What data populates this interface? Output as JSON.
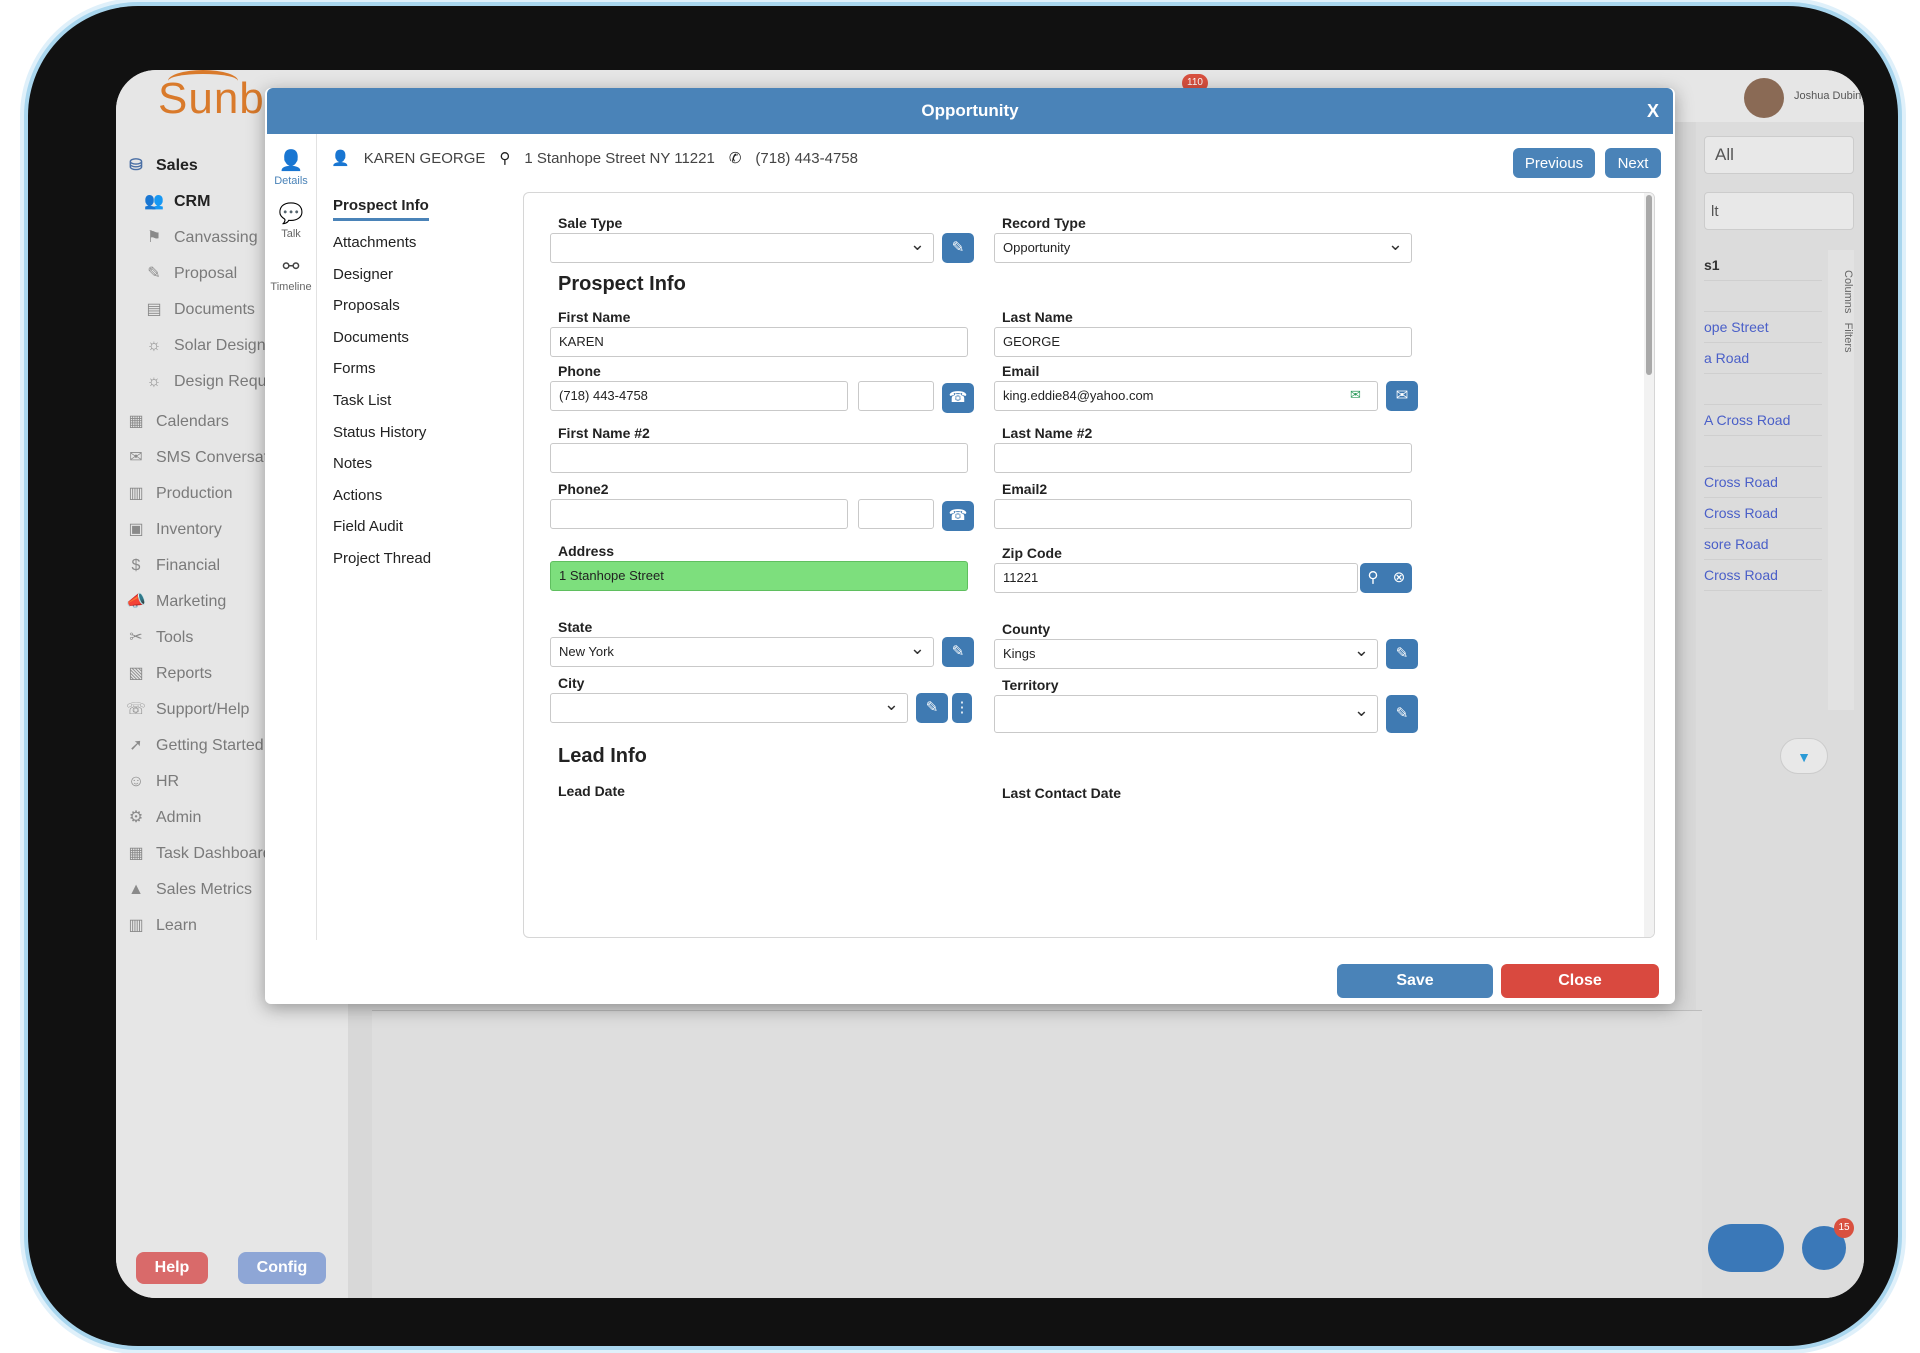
{
  "app": {
    "brand": "Sunbas",
    "user_name": "Joshua Dubin",
    "notifications_count": "110",
    "chat_count": "15"
  },
  "sidebar": {
    "items": [
      {
        "label": "Sales",
        "icon": "dollar-icon",
        "glyph": "⛁"
      },
      {
        "label": "CRM",
        "icon": "people-icon",
        "glyph": "👥"
      },
      {
        "label": "Canvassing",
        "icon": "walk-icon",
        "glyph": "⚑"
      },
      {
        "label": "Proposal",
        "icon": "edit-doc-icon",
        "glyph": "✎"
      },
      {
        "label": "Documents",
        "icon": "document-icon",
        "glyph": "▤"
      },
      {
        "label": "Solar Designer",
        "icon": "solar-icon",
        "glyph": "☼"
      },
      {
        "label": "Design Request",
        "icon": "request-icon",
        "glyph": "☼"
      },
      {
        "label": "Calendars",
        "icon": "calendar-icon",
        "glyph": "▦"
      },
      {
        "label": "SMS Conversations",
        "icon": "sms-icon",
        "glyph": "✉"
      },
      {
        "label": "Production",
        "icon": "production-icon",
        "glyph": "▥"
      },
      {
        "label": "Inventory",
        "icon": "inventory-icon",
        "glyph": "▣"
      },
      {
        "label": "Financial",
        "icon": "financial-icon",
        "glyph": "$"
      },
      {
        "label": "Marketing",
        "icon": "megaphone-icon",
        "glyph": "📣"
      },
      {
        "label": "Tools",
        "icon": "tools-icon",
        "glyph": "✂"
      },
      {
        "label": "Reports",
        "icon": "reports-icon",
        "glyph": "▧"
      },
      {
        "label": "Support/Help",
        "icon": "headset-icon",
        "glyph": "☏"
      },
      {
        "label": "Getting Started",
        "icon": "rocket-icon",
        "glyph": "➚"
      },
      {
        "label": "HR",
        "icon": "person-icon",
        "glyph": "☺"
      },
      {
        "label": "Admin",
        "icon": "admin-icon",
        "glyph": "⚙"
      },
      {
        "label": "Task Dashboard",
        "icon": "dashboard-icon",
        "glyph": "▦"
      },
      {
        "label": "Sales Metrics",
        "icon": "metrics-icon",
        "glyph": "▲"
      },
      {
        "label": "Learn",
        "icon": "books-icon",
        "glyph": "▥"
      }
    ],
    "help_label": "Help",
    "config_label": "Config"
  },
  "background": {
    "filter_all": "All",
    "filter_second": "lt",
    "header_cell": "s1",
    "rows": [
      "",
      "ope Street",
      "a Road",
      "",
      "A Cross Road",
      "",
      "Cross Road",
      "Cross Road",
      "sore Road",
      "Cross Road"
    ],
    "side_tabs": [
      "Columns",
      "Filters"
    ]
  },
  "modal": {
    "title": "Opportunity",
    "close_x": "X",
    "iconbar": [
      {
        "label": "Details",
        "icon": "person-icon",
        "glyph": "👤"
      },
      {
        "label": "Talk",
        "icon": "chat-icon",
        "glyph": "💬"
      },
      {
        "label": "Timeline",
        "icon": "timeline-icon",
        "glyph": "⚯"
      }
    ],
    "contact_name": "KAREN GEORGE",
    "contact_address": "1 Stanhope Street NY 11221",
    "contact_phone": "(718) 443-4758",
    "previous_label": "Previous",
    "next_label": "Next",
    "subnav": [
      "Prospect Info",
      "Attachments",
      "Designer",
      "Proposals",
      "Documents",
      "Forms",
      "Task List",
      "Status History",
      "Notes",
      "Actions",
      "Field Audit",
      "Project Thread"
    ],
    "save_label": "Save",
    "close_label": "Close"
  },
  "form": {
    "sale_type_label": "Sale Type",
    "sale_type_value": "",
    "record_type_label": "Record Type",
    "record_type_value": "Opportunity",
    "prospect_section": "Prospect Info",
    "first_name_label": "First Name",
    "first_name_value": "KAREN",
    "last_name_label": "Last Name",
    "last_name_value": "GEORGE",
    "phone_label": "Phone",
    "phone_value": "(718) 443-4758",
    "phone_ext_value": "",
    "email_label": "Email",
    "email_value": "king.eddie84@yahoo.com",
    "first_name2_label": "First Name #2",
    "first_name2_value": "",
    "last_name2_label": "Last Name #2",
    "last_name2_value": "",
    "phone2_label": "Phone2",
    "phone2_value": "",
    "phone2_ext_value": "",
    "email2_label": "Email2",
    "email2_value": "",
    "address_label": "Address",
    "address_value": "1 Stanhope Street",
    "zip_label": "Zip Code",
    "zip_value": "11221",
    "state_label": "State",
    "state_value": "New York",
    "county_label": "County",
    "county_value": "Kings",
    "city_label": "City",
    "city_value": "",
    "territory_label": "Territory",
    "territory_value": "",
    "lead_section": "Lead Info",
    "lead_date_label": "Lead Date",
    "last_contact_label": "Last Contact Date"
  },
  "colors": {
    "accent": "#4a83b8",
    "danger": "#d9493f",
    "address_highlight": "#7ddf7d",
    "brand": "#d97a2b"
  }
}
